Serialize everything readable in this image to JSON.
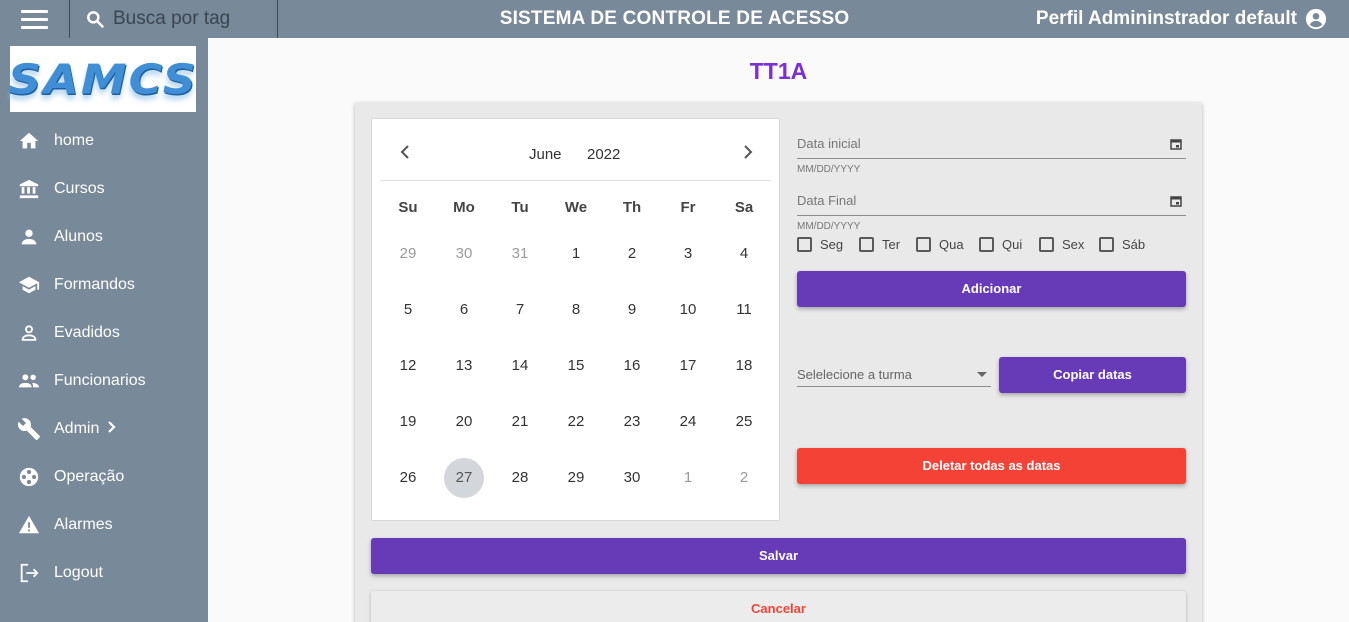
{
  "header": {
    "search_placeholder": "Busca por tag",
    "app_title": "SISTEMA DE CONTROLE DE ACESSO",
    "profile_label": "Perfil Admininstrador default"
  },
  "sidebar": {
    "logo_text": "SAMCS",
    "items": [
      {
        "label": "home",
        "icon": "home-icon"
      },
      {
        "label": "Cursos",
        "icon": "institution-icon"
      },
      {
        "label": "Alunos",
        "icon": "person-icon"
      },
      {
        "label": "Formandos",
        "icon": "graduation-cap-icon"
      },
      {
        "label": "Evadidos",
        "icon": "person-outline-icon"
      },
      {
        "label": "Funcionarios",
        "icon": "people-icon"
      },
      {
        "label": "Admin",
        "icon": "wrench-icon"
      },
      {
        "label": "Operação",
        "icon": "film-reel-icon"
      },
      {
        "label": "Alarmes",
        "icon": "warning-icon"
      },
      {
        "label": "Logout",
        "icon": "logout-icon"
      }
    ]
  },
  "page": {
    "title": "TT1A"
  },
  "calendar": {
    "month": "June",
    "year": "2022",
    "weekdays": [
      "Su",
      "Mo",
      "Tu",
      "We",
      "Th",
      "Fr",
      "Sa"
    ],
    "weeks": [
      [
        {
          "d": "29",
          "o": true
        },
        {
          "d": "30",
          "o": true
        },
        {
          "d": "31",
          "o": true
        },
        {
          "d": "1"
        },
        {
          "d": "2"
        },
        {
          "d": "3"
        },
        {
          "d": "4"
        }
      ],
      [
        {
          "d": "5"
        },
        {
          "d": "6"
        },
        {
          "d": "7"
        },
        {
          "d": "8"
        },
        {
          "d": "9"
        },
        {
          "d": "10"
        },
        {
          "d": "11"
        }
      ],
      [
        {
          "d": "12"
        },
        {
          "d": "13"
        },
        {
          "d": "14"
        },
        {
          "d": "15"
        },
        {
          "d": "16"
        },
        {
          "d": "17"
        },
        {
          "d": "18"
        }
      ],
      [
        {
          "d": "19"
        },
        {
          "d": "20"
        },
        {
          "d": "21"
        },
        {
          "d": "22"
        },
        {
          "d": "23"
        },
        {
          "d": "24"
        },
        {
          "d": "25"
        }
      ],
      [
        {
          "d": "26"
        },
        {
          "d": "27",
          "s": true
        },
        {
          "d": "28"
        },
        {
          "d": "29"
        },
        {
          "d": "30"
        },
        {
          "d": "1",
          "o": true
        },
        {
          "d": "2",
          "o": true
        }
      ]
    ]
  },
  "form": {
    "start_date_label": "Data inicial",
    "start_date_hint": "MM/DD/YYYY",
    "end_date_label": "Data Final",
    "end_date_hint": "MM/DD/YYYY",
    "weekdays": [
      "Seg",
      "Ter",
      "Qua",
      "Qui",
      "Sex",
      "Sáb"
    ],
    "add_button": "Adicionar",
    "select_placeholder": "Selelecione a turma",
    "copy_button": "Copiar datas",
    "delete_button": "Deletar todas as datas",
    "save_button": "Salvar",
    "cancel_button": "Cancelar"
  },
  "colors": {
    "header_bg": "#78899a",
    "title_purple": "#7b2fd6",
    "button_purple": "#673ab7",
    "button_red": "#f44336"
  }
}
